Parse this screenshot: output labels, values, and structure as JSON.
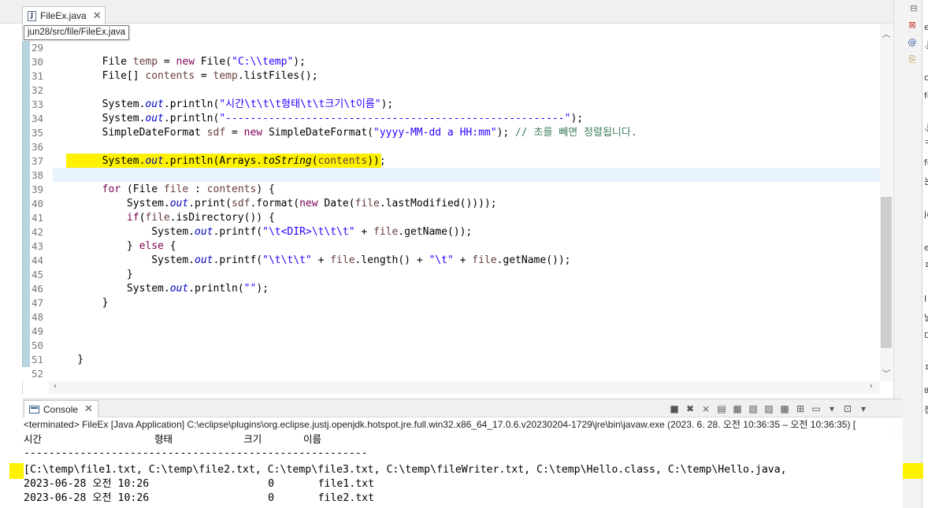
{
  "editor_tab": {
    "label": "FileEx.java",
    "tooltip": "jun28/src/file/FileEx.java"
  },
  "line_numbers": [
    "29",
    "30",
    "31",
    "32",
    "33",
    "34",
    "35",
    "36",
    "37",
    "38",
    "39",
    "40",
    "41",
    "42",
    "43",
    "44",
    "45",
    "46",
    "47",
    "48",
    "49",
    "50",
    "51",
    "52"
  ],
  "code": {
    "l30": {
      "a": "        File ",
      "b": "temp",
      "c": " = ",
      "d": "new",
      "e": " File(",
      "f": "\"C:\\\\temp\"",
      "g": ");"
    },
    "l31": {
      "a": "        File[] ",
      "b": "contents",
      "c": " = ",
      "d": "temp",
      "e": ".listFiles();"
    },
    "l33": {
      "a": "        System.",
      "b": "out",
      "c": ".println(",
      "d": "\"시간\\t\\t\\t형태\\t\\t크기\\t이름\"",
      "e": ");"
    },
    "l34": {
      "a": "        System.",
      "b": "out",
      "c": ".println(",
      "d": "\"-------------------------------------------------------\"",
      "e": ");"
    },
    "l35": {
      "a": "        SimpleDateFormat ",
      "b": "sdf",
      "c": " = ",
      "d": "new",
      "e": " SimpleDateFormat(",
      "f": "\"yyyy-MM-dd a HH:mm\"",
      "g": "); ",
      "h": "// 초를 빼면 정렬됩니다."
    },
    "l37": {
      "a": "        System.",
      "b": "out",
      "c": ".println(Arrays.",
      "d": "toString",
      "e": "(",
      "f": "contents",
      "g": "));"
    },
    "l39": {
      "a": "        ",
      "b": "for",
      "c": " (File ",
      "d": "file",
      "e": " : ",
      "f": "contents",
      "g": ") {"
    },
    "l40": {
      "a": "            System.",
      "b": "out",
      "c": ".print(",
      "d": "sdf",
      "e": ".format(",
      "f": "new",
      "g": " Date(",
      "h": "file",
      "i": ".lastModified())));"
    },
    "l41": {
      "a": "            ",
      "b": "if",
      "c": "(",
      "d": "file",
      "e": ".isDirectory()) {"
    },
    "l42": {
      "a": "                System.",
      "b": "out",
      "c": ".printf(",
      "d": "\"\\t<DIR>\\t\\t\\t\"",
      "e": " + ",
      "f": "file",
      "g": ".getName());"
    },
    "l43": {
      "a": "            } ",
      "b": "else",
      "c": " {"
    },
    "l44": {
      "a": "                System.",
      "b": "out",
      "c": ".printf(",
      "d": "\"\\t\\t\\t\"",
      "e": " + ",
      "f": "file",
      "g": ".length() + ",
      "h": "\"\\t\"",
      "i": " + ",
      "j": "file",
      "k": ".getName());"
    },
    "l45": "            }",
    "l46": {
      "a": "            System.",
      "b": "out",
      "c": ".println(",
      "d": "\"\"",
      "e": ");"
    },
    "l47": "        }",
    "l51": "    }"
  },
  "console": {
    "tab_label": "Console",
    "terminated": "<terminated> FileEx [Java Application] C:\\eclipse\\plugins\\org.eclipse.justj.openjdk.hotspot.jre.full.win32.x86_64_17.0.6.v20230204-1729\\jre\\bin\\javaw.exe  (2023. 6. 28. 오전 10:36:35 – 오전 10:36:35) [",
    "header": "시간                   형태            크기       이름",
    "dashes": "-------------------------------------------------------",
    "array_line": "[C:\\temp\\file1.txt, C:\\temp\\file2.txt, C:\\temp\\file3.txt, C:\\temp\\fileWriter.txt, C:\\temp\\Hello.class, C:\\temp\\Hello.java,",
    "rows": [
      "2023-06-28 오전 10:26                   0       file1.txt",
      "2023-06-28 오전 10:26                   0       file2.txt"
    ]
  },
  "right_strip": {
    "chars": [
      "e",
      ".j",
      "cl",
      "fo",
      ".j",
      "ㅋ",
      "fo",
      "논",
      "ja",
      "e.",
      "ㅍ",
      "I",
      "날",
      "다",
      "ㅍ",
      "배",
      "장"
    ]
  },
  "colors": {
    "highlight": "#fff200",
    "keyword": "#7f0055",
    "string": "#2a00ff",
    "field": "#0000c0",
    "comment": "#3f7f5f"
  }
}
